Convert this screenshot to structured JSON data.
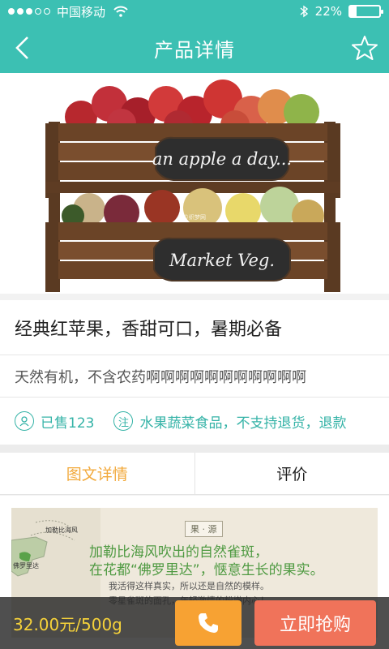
{
  "status_bar": {
    "carrier": "中国移动",
    "battery": "22%",
    "battery_level": 0.22,
    "icons": [
      "signal-icon",
      "wifi-icon",
      "bluetooth-icon",
      "battery-icon"
    ]
  },
  "nav": {
    "title": "产品详情",
    "back_icon": "chevron-left-icon",
    "favorite_icon": "star-outline-icon"
  },
  "hero_image": {
    "sign_top": "an apple a day...",
    "sign_bottom": "Market Veg.",
    "watermark": "©织梦网"
  },
  "product": {
    "title": "经典红苹果，香甜可口，暑期必备",
    "description": "天然有机，不含农药啊啊啊啊啊啊啊啊啊啊啊",
    "sold_label": "已售123",
    "note_icon_text": "注",
    "note": "水果蔬菜食品，不支持退货，退款"
  },
  "tabs": [
    {
      "label": "图文详情",
      "active": true
    },
    {
      "label": "评价",
      "active": false
    }
  ],
  "detail_poster": {
    "tag": "果 · 源",
    "line1": "加勒比海风吹出的自然雀斑，",
    "line2": "在花都“佛罗里达”，惬意生长的果实。",
    "line3": "我活得这样真实，所以还是自然的模样。",
    "line4": "零星雀斑的面孔，年轻激情的粉嫩内心！",
    "map_label_caribbean": "加勒比海风",
    "map_label_florida": "佛罗里达"
  },
  "bottom_bar": {
    "price": "32.00元/500g",
    "call_icon": "phone-icon",
    "buy_label": "立即抢购"
  },
  "colors": {
    "brand": "#3cc0b3",
    "tab_active": "#f2a93b",
    "price": "#f6d23a",
    "call_button": "#f7a233",
    "buy_button": "#f0735a"
  }
}
